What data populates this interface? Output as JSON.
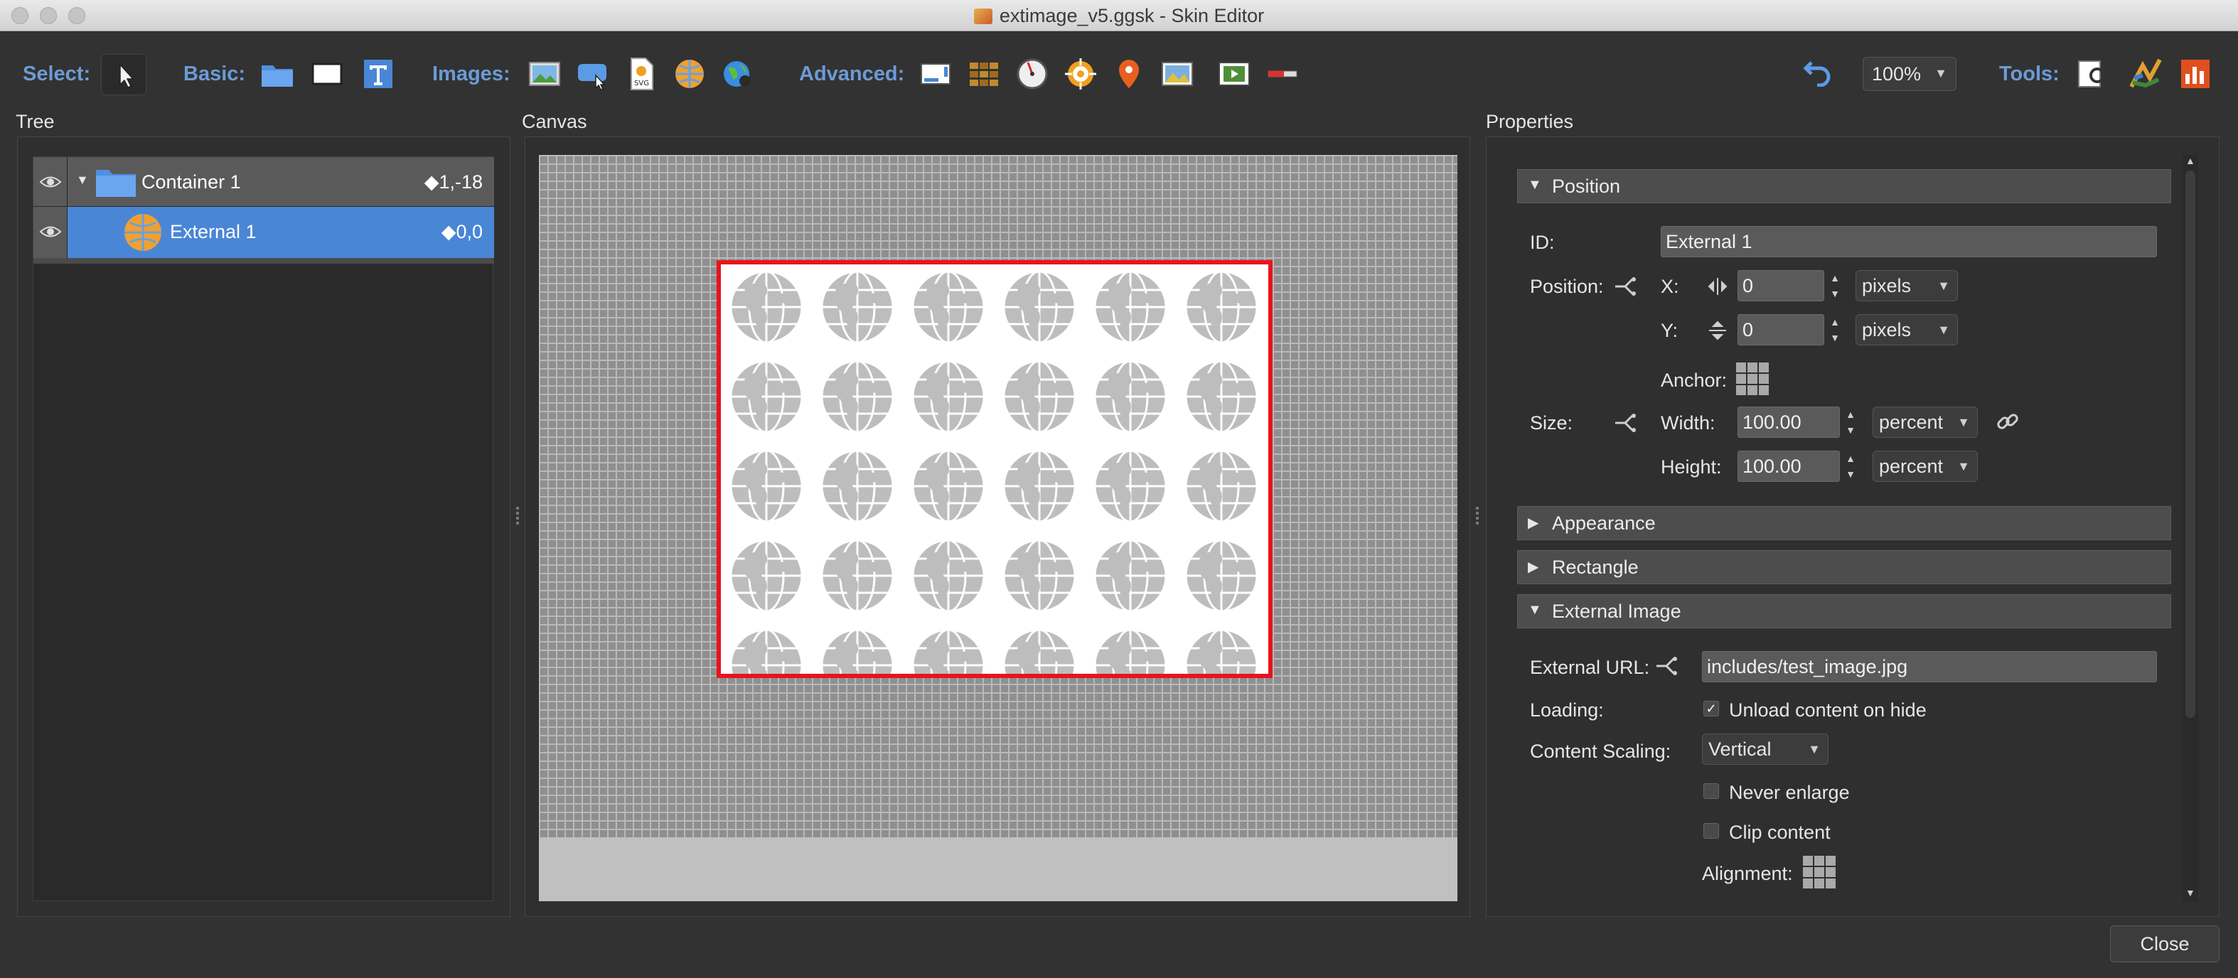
{
  "window": {
    "title": "extimage_v5.ggsk - Skin Editor"
  },
  "toolbar": {
    "select_label": "Select:",
    "basic_label": "Basic:",
    "images_label": "Images:",
    "advanced_label": "Advanced:",
    "zoom_value": "100%",
    "tools_label": "Tools:",
    "icons": {
      "select": "cursor-arrow-icon",
      "basic": [
        "folder-icon",
        "rectangle-icon",
        "text-icon"
      ],
      "images": [
        "image-icon",
        "button-image-icon",
        "svg-icon",
        "external-image-icon",
        "cloner-icon"
      ],
      "advanced": [
        "scroll-area-icon",
        "map-grid-icon",
        "dial-icon",
        "hotspot-icon",
        "map-pin-icon",
        "map-image-icon",
        "video-icon",
        "progress-icon"
      ],
      "tools": [
        "undo-icon",
        "search-tool-icon",
        "skin-tool-icon",
        "chart-tool-icon"
      ]
    }
  },
  "tree": {
    "title": "Tree",
    "items": [
      {
        "label": "Container 1",
        "coord": "◆1,-18",
        "selected": false
      },
      {
        "label": "External 1",
        "coord": "◆0,0",
        "selected": true
      }
    ]
  },
  "canvas": {
    "title": "Canvas"
  },
  "properties": {
    "title": "Properties",
    "sections": {
      "position": "Position",
      "appearance": "Appearance",
      "rectangle": "Rectangle",
      "external_image": "External Image"
    },
    "id_label": "ID:",
    "id_value": "External 1",
    "position_label": "Position:",
    "x_label": "X:",
    "x_value": "0",
    "x_unit": "pixels",
    "y_label": "Y:",
    "y_value": "0",
    "y_unit": "pixels",
    "anchor_label": "Anchor:",
    "size_label": "Size:",
    "width_label": "Width:",
    "width_value": "100.00",
    "width_unit": "percent",
    "height_label": "Height:",
    "height_value": "100.00",
    "height_unit": "percent",
    "external_url_label": "External URL:",
    "external_url_value": "includes/test_image.jpg",
    "loading_label": "Loading:",
    "unload_label": "Unload content on hide",
    "unload_checked": true,
    "content_scaling_label": "Content Scaling:",
    "content_scaling_value": "Vertical",
    "never_enlarge_label": "Never enlarge",
    "never_enlarge_checked": false,
    "clip_content_label": "Clip content",
    "clip_content_checked": false,
    "alignment_label": "Alignment:"
  },
  "buttons": {
    "close": "Close"
  },
  "colors": {
    "accent": "#6c9bd6",
    "selection": "#4a86d6",
    "selection_border": "#e8141b"
  }
}
